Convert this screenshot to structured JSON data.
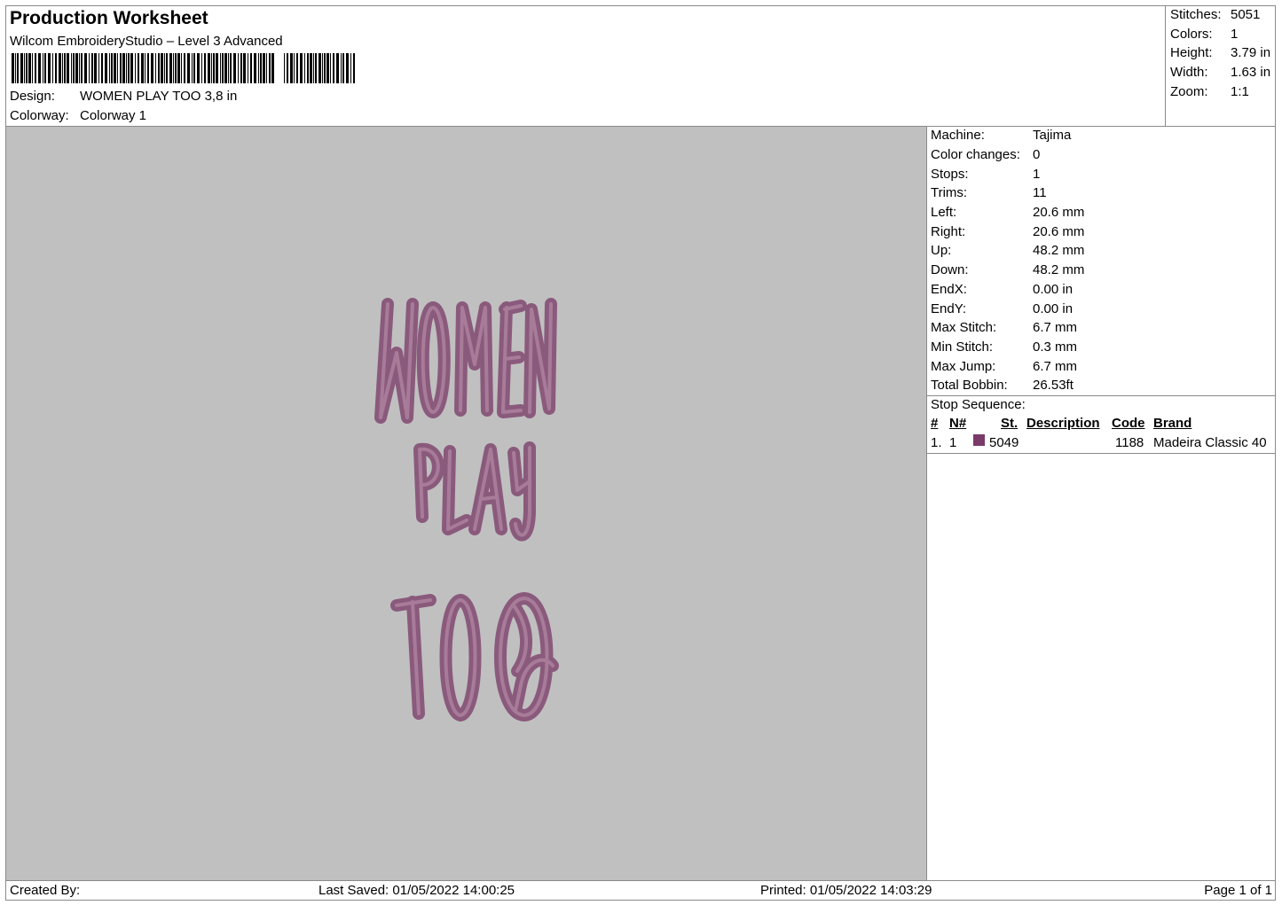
{
  "header": {
    "title": "Production Worksheet",
    "subtitle": "Wilcom EmbroideryStudio – Level 3 Advanced",
    "design_label": "Design:",
    "design_value": "WOMEN PLAY TOO 3,8 in",
    "colorway_label": "Colorway:",
    "colorway_value": "Colorway 1"
  },
  "stats": [
    {
      "label": "Stitches:",
      "value": "5051"
    },
    {
      "label": "Colors:",
      "value": "1"
    },
    {
      "label": "Height:",
      "value": "3.79 in"
    },
    {
      "label": "Width:",
      "value": "1.63 in"
    },
    {
      "label": "Zoom:",
      "value": "1:1"
    }
  ],
  "machine_info": [
    {
      "label": "Machine:",
      "value": "Tajima"
    },
    {
      "label": "Color changes:",
      "value": "0"
    },
    {
      "label": "Stops:",
      "value": "1"
    },
    {
      "label": "Trims:",
      "value": "11"
    },
    {
      "label": "Left:",
      "value": "20.6 mm"
    },
    {
      "label": "Right:",
      "value": "20.6 mm"
    },
    {
      "label": "Up:",
      "value": "48.2 mm"
    },
    {
      "label": "Down:",
      "value": "48.2 mm"
    },
    {
      "label": "EndX:",
      "value": "0.00 in"
    },
    {
      "label": "EndY:",
      "value": "0.00 in"
    },
    {
      "label": "Max Stitch:",
      "value": "6.7 mm"
    },
    {
      "label": "Min Stitch:",
      "value": "0.3 mm"
    },
    {
      "label": "Max Jump:",
      "value": "6.7 mm"
    },
    {
      "label": "Total Bobbin:",
      "value": "26.53ft"
    }
  ],
  "stop_sequence": {
    "title": "Stop Sequence:",
    "headers": {
      "num": "#",
      "n": "N#",
      "st": "St.",
      "description": "Description",
      "code": "Code",
      "brand": "Brand"
    },
    "rows": [
      {
        "num": "1.",
        "n": "1",
        "color": "#7a3a6a",
        "st": "5049",
        "description": "",
        "code": "1188",
        "brand": "Madeira Classic 40"
      }
    ]
  },
  "design": {
    "thread_color": "#8a5a7c",
    "thread_highlight": "#b58aa6"
  },
  "footer": {
    "created_by": "Created By:",
    "last_saved": "Last Saved: 01/05/2022 14:00:25",
    "printed": "Printed: 01/05/2022 14:03:29",
    "page": "Page 1 of 1"
  }
}
